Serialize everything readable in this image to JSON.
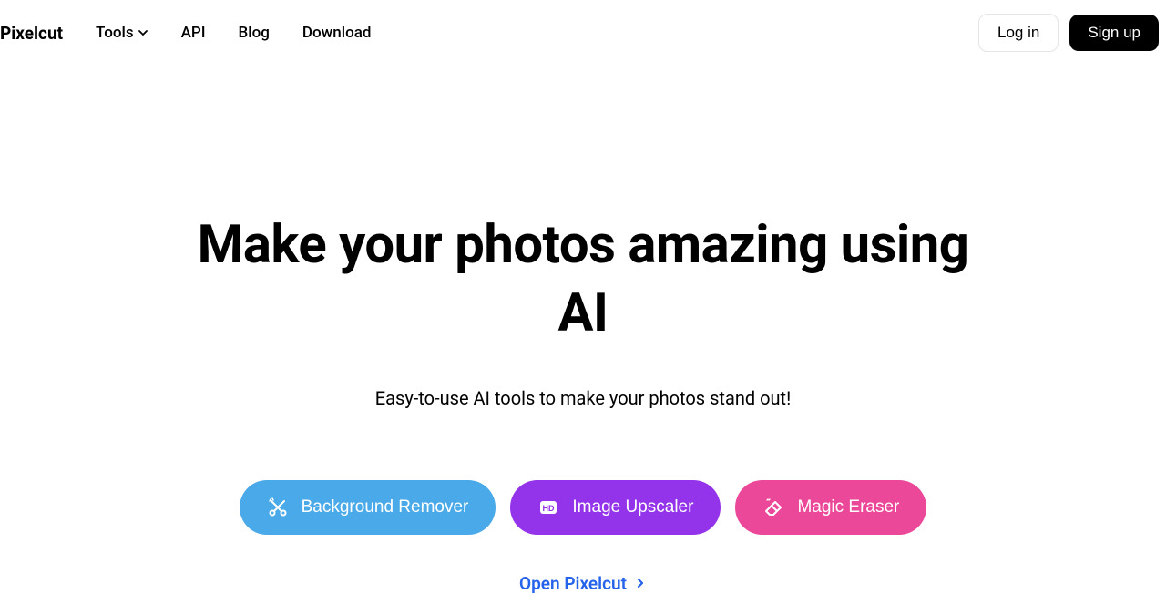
{
  "header": {
    "logo": "Pixelcut",
    "nav": {
      "tools": "Tools",
      "api": "API",
      "blog": "Blog",
      "download": "Download"
    },
    "login": "Log in",
    "signup": "Sign up"
  },
  "hero": {
    "title": "Make your photos amazing using AI",
    "subtitle": "Easy-to-use AI tools to make your photos stand out!",
    "tools": {
      "bg_remover": "Background Remover",
      "upscaler": "Image Upscaler",
      "eraser": "Magic Eraser"
    },
    "open_link": "Open Pixelcut"
  }
}
